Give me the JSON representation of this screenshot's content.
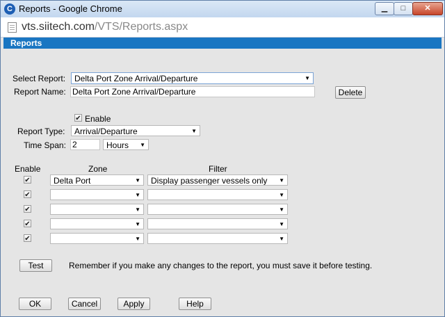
{
  "window": {
    "app_icon": "chrome-logo-icon",
    "title": "Reports - Google Chrome",
    "controls": [
      "minimize-icon",
      "maximize-icon",
      "close-icon"
    ]
  },
  "address": {
    "domain": "vts.siitech.com",
    "path": "/VTS/Reports.aspx",
    "icon": "page-icon"
  },
  "banner": {
    "title": "Reports"
  },
  "form": {
    "select_report_label": "Select Report:",
    "select_report_value": "Delta Port Zone Arrival/Departure",
    "report_name_label": "Report Name:",
    "report_name_value": "Delta Port Zone Arrival/Departure",
    "delete_label": "Delete",
    "enable_label": "Enable",
    "enable_checked": true,
    "report_type_label": "Report Type:",
    "report_type_value": "Arrival/Departure",
    "time_span_label": "Time Span:",
    "time_span_value": "2",
    "time_unit_value": "Hours"
  },
  "zones": {
    "headers": {
      "enable": "Enable",
      "zone": "Zone",
      "filter": "Filter"
    },
    "rows": [
      {
        "enabled": true,
        "zone": "Delta Port",
        "filter": "Display passenger vessels only"
      },
      {
        "enabled": true,
        "zone": "",
        "filter": ""
      },
      {
        "enabled": true,
        "zone": "",
        "filter": ""
      },
      {
        "enabled": true,
        "zone": "",
        "filter": ""
      },
      {
        "enabled": true,
        "zone": "",
        "filter": ""
      }
    ]
  },
  "test": {
    "button_label": "Test",
    "note": "Remember if you make any changes to the report, you must save it before testing."
  },
  "footer": {
    "ok": "OK",
    "cancel": "Cancel",
    "apply": "Apply",
    "help": "Help"
  },
  "glyphs": {
    "dropdown_arrow": "▼",
    "check": "✔",
    "minimize": "▁",
    "maximize": "□",
    "close": "✕"
  }
}
